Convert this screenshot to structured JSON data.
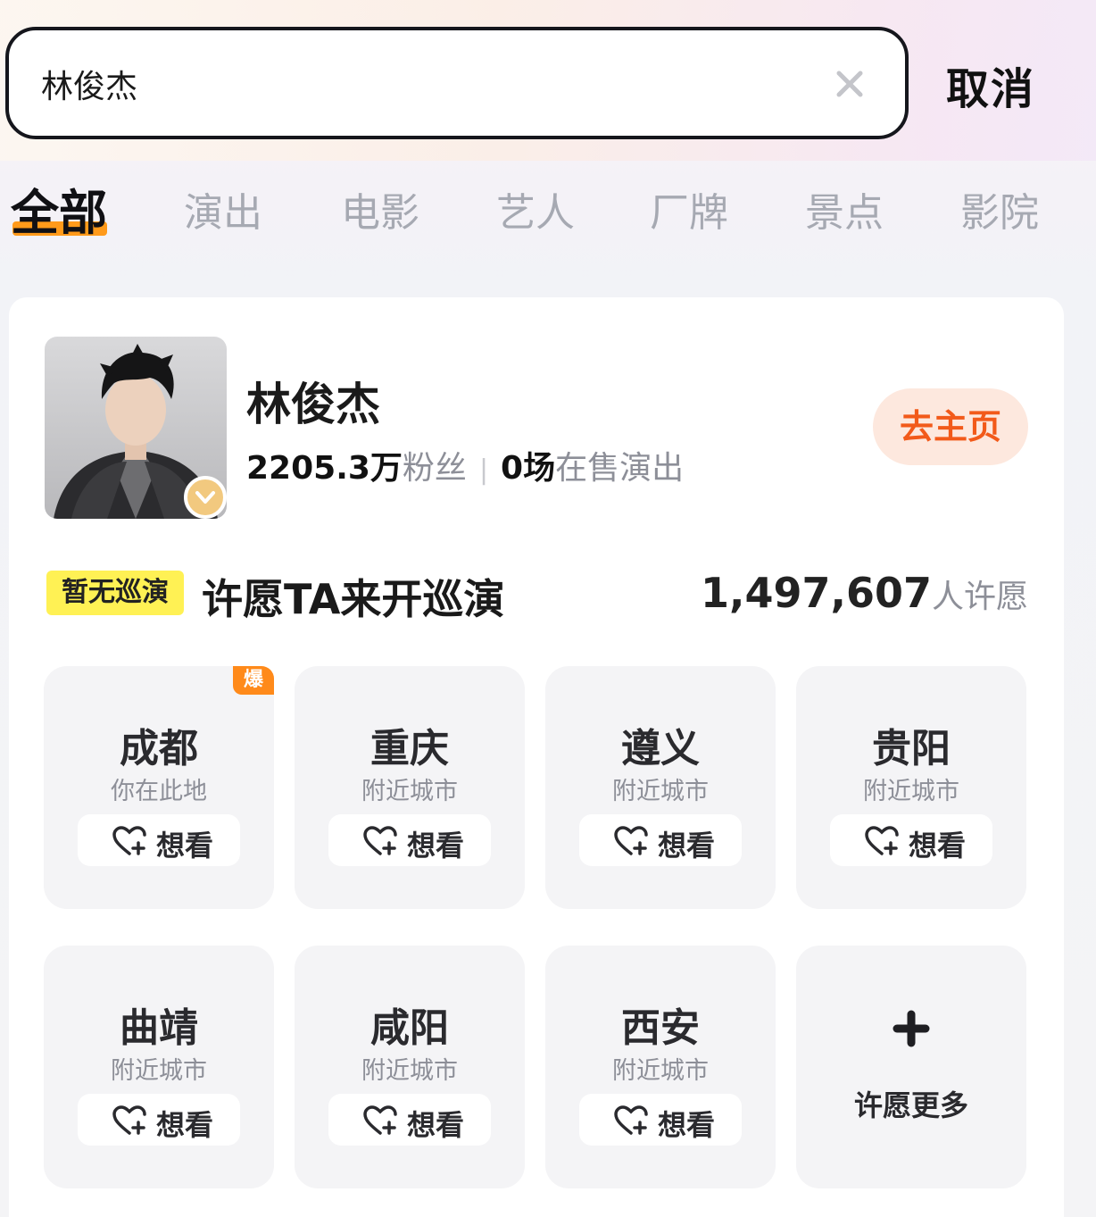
{
  "search": {
    "query": "林俊杰",
    "cancel_label": "取消"
  },
  "tabs": [
    {
      "label": "全部",
      "active": true
    },
    {
      "label": "演出"
    },
    {
      "label": "电影"
    },
    {
      "label": "艺人"
    },
    {
      "label": "厂牌"
    },
    {
      "label": "景点"
    },
    {
      "label": "影院"
    }
  ],
  "artist": {
    "name": "林俊杰",
    "fans_count": "2205.3万",
    "fans_label": "粉丝",
    "shows_count": "0场",
    "shows_label": "在售演出",
    "home_button": "去主页"
  },
  "tour": {
    "tag": "暂无巡演",
    "title": "许愿TA来开巡演",
    "wish_count": "1,497,607",
    "wish_unit": "人许愿"
  },
  "cities": [
    {
      "name": "成都",
      "sub": "你在此地",
      "want": "想看",
      "hot": "爆"
    },
    {
      "name": "重庆",
      "sub": "附近城市",
      "want": "想看"
    },
    {
      "name": "遵义",
      "sub": "附近城市",
      "want": "想看"
    },
    {
      "name": "贵阳",
      "sub": "附近城市",
      "want": "想看"
    },
    {
      "name": "曲靖",
      "sub": "附近城市",
      "want": "想看"
    },
    {
      "name": "咸阳",
      "sub": "附近城市",
      "want": "想看"
    },
    {
      "name": "西安",
      "sub": "附近城市",
      "want": "想看"
    }
  ],
  "more_wish": {
    "label": "许愿更多"
  },
  "colors": {
    "accent": "#ff9a1a",
    "home_btn_text": "#f25a1a",
    "home_btn_bg": "#fde8de",
    "tour_tag_bg": "#fff154"
  }
}
